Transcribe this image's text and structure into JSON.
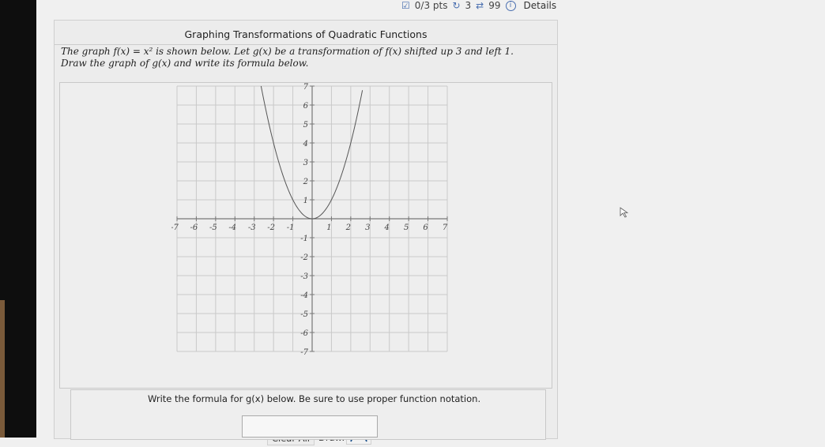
{
  "header": {
    "points": "0/3 pts",
    "retries": "3",
    "attempts": "99",
    "details_label": "Details"
  },
  "question": {
    "title": "Graphing Transformations of Quadratic Functions",
    "prompt_line1": "The graph f(x) = x² is shown below. Let g(x) be a transformation of f(x) shifted up 3 and left 1.",
    "prompt_line2": "Draw the graph of g(x) and write its formula below."
  },
  "graph": {
    "function": "f(x) = x^2",
    "xlim": [
      -7,
      7
    ],
    "ylim": [
      -7,
      7
    ],
    "x_tick_labels": [
      "-7",
      "-6",
      "-5",
      "-4",
      "-3",
      "-2",
      "-1",
      "1",
      "2",
      "3",
      "4",
      "5",
      "6",
      "7"
    ],
    "y_tick_labels": [
      "7",
      "6",
      "5",
      "4",
      "3",
      "2",
      "1",
      "-1",
      "-2",
      "-3",
      "-4",
      "-5",
      "-6",
      "-7"
    ],
    "grid": true,
    "curve_color": "#555555"
  },
  "toolbar": {
    "clear_all_label": "Clear All",
    "draw_label": "Draw:",
    "tool_icon": "parabola-tool-icon"
  },
  "formula": {
    "instruction": "Write the formula for g(x) below. Be sure to use proper function notation.",
    "input_value": ""
  }
}
